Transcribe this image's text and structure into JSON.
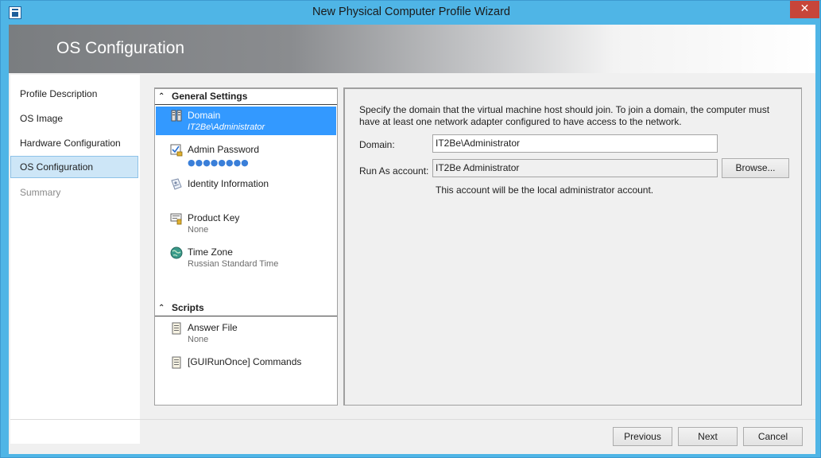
{
  "window": {
    "title": "New Physical Computer Profile Wizard",
    "close_glyph": "✕"
  },
  "banner": {
    "title": "OS Configuration"
  },
  "nav": {
    "items": [
      {
        "label": "Profile Description"
      },
      {
        "label": "OS Image"
      },
      {
        "label": "Hardware Configuration"
      },
      {
        "label": "OS Configuration"
      },
      {
        "label": "Summary"
      }
    ],
    "selected": "OS Configuration"
  },
  "settings": {
    "general_header": "General Settings",
    "scripts_header": "Scripts",
    "collapse_glyph": "❯",
    "general_items": [
      {
        "name": "Domain",
        "value": "IT2Be\\Administrator",
        "icon": "domain-icon"
      },
      {
        "name": "Admin Password",
        "value": "●●●●●●●●",
        "icon": "password-icon"
      },
      {
        "name": "Identity Information",
        "value": "",
        "icon": "identity-icon"
      },
      {
        "name": "Product Key",
        "value": "None",
        "icon": "product-key-icon"
      },
      {
        "name": "Time Zone",
        "value": "Russian Standard Time",
        "icon": "globe-icon"
      }
    ],
    "script_items": [
      {
        "name": "Answer File",
        "value": "None",
        "icon": "document-icon"
      },
      {
        "name": "[GUIRunOnce] Commands",
        "value": "",
        "icon": "document-icon"
      }
    ]
  },
  "detail": {
    "description": "Specify the domain that the virtual machine host should join. To join a domain, the computer must have at least one network adapter configured to have access to the network.",
    "domain_label": "Domain:",
    "domain_value": "IT2Be\\Administrator",
    "run_as_label": "Run As account:",
    "run_as_value": "IT2Be Administrator",
    "browse_label": "Browse...",
    "note": "This account will be the local administrator account."
  },
  "footer": {
    "previous_label": "Previous",
    "next_label": "Next",
    "cancel_label": "Cancel"
  },
  "colors": {
    "titlebar": "#4fb5e6",
    "selection": "#3399ff",
    "nav_selected": "#cde6f7",
    "close": "#c7453a"
  }
}
